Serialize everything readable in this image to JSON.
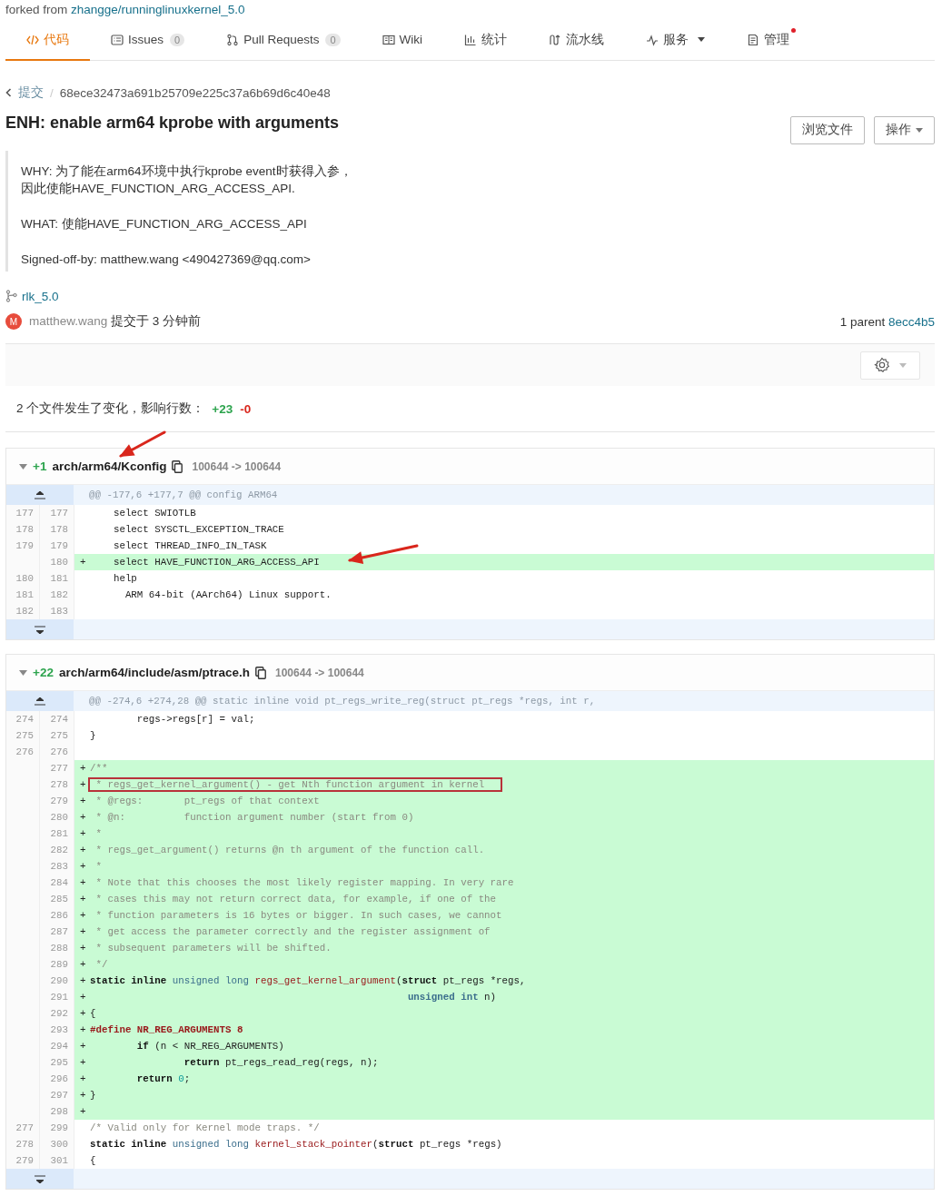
{
  "fork": {
    "prefix": "forked from",
    "link": "zhangge/runninglinuxkernel_5.0"
  },
  "tabs": [
    {
      "label": "代码",
      "selected": true
    },
    {
      "label": "Issues",
      "count": "0",
      "selected": false
    },
    {
      "label": "Pull Requests",
      "count": "0",
      "selected": false
    },
    {
      "label": "Wiki",
      "selected": false
    },
    {
      "label": "统计",
      "selected": false
    },
    {
      "label": "流水线",
      "selected": false
    },
    {
      "label": "服务",
      "dropdown": true,
      "selected": false
    },
    {
      "label": "管理",
      "notify": true,
      "selected": false
    }
  ],
  "breadcrumb": {
    "parent": "提交",
    "separator": "/",
    "current": "68ece32473a691b25709e225c37a6b69d6c40e48"
  },
  "commit": {
    "title": "ENH: enable arm64 kprobe with arguments",
    "buttons": [
      {
        "label": "浏览文件",
        "dropdown": false
      },
      {
        "label": "操作",
        "dropdown": true
      }
    ],
    "message": [
      [
        "WHY: 为了能在arm64环境中执行kprobe event时获得入参，",
        "因此使能HAVE_FUNCTION_ARG_ACCESS_API."
      ],
      [
        "WHAT: 使能HAVE_FUNCTION_ARG_ACCESS_API"
      ],
      [
        "Signed-off-by: matthew.wang <490427369@qq.com>"
      ]
    ],
    "branch": "rlk_5.0",
    "author": {
      "initial": "M",
      "name": "matthew.wang",
      "action": "提交于 3 分钟前"
    },
    "parent": {
      "label": "1 parent",
      "hash": "8ecc4b5"
    }
  },
  "stats": {
    "summary": "2 个文件发生了变化，影响行数：",
    "additions": "+23",
    "deletions": "-0"
  },
  "files": [
    {
      "additions": "+1",
      "path": "arch/arm64/Kconfig",
      "mode": "100644 -> 100644",
      "arrow": true,
      "hunk": "@@ -177,6 +177,7 @@ config ARM64",
      "lines": [
        {
          "old": "177",
          "new": "177",
          "added": false,
          "code": [
            {
              "kind": "plain",
              "text": "    select SWIOTLB"
            }
          ]
        },
        {
          "old": "178",
          "new": "178",
          "added": false,
          "code": [
            {
              "kind": "plain",
              "text": "    select SYSCTL_EXCEPTION_TRACE"
            }
          ]
        },
        {
          "old": "179",
          "new": "179",
          "added": false,
          "code": [
            {
              "kind": "plain",
              "text": "    select THREAD_INFO_IN_TASK"
            }
          ]
        },
        {
          "new": "180",
          "added": true,
          "marker": "+",
          "arrow": true,
          "code": [
            {
              "kind": "plain",
              "text": "    select HAVE_FUNCTION_ARG_ACCESS_API"
            }
          ]
        },
        {
          "old": "180",
          "new": "181",
          "added": false,
          "code": [
            {
              "kind": "plain",
              "text": "    help"
            }
          ]
        },
        {
          "old": "181",
          "new": "182",
          "added": false,
          "code": [
            {
              "kind": "plain",
              "text": "      ARM 64-bit (AArch64) Linux support."
            }
          ]
        },
        {
          "old": "182",
          "new": "183",
          "added": false
        }
      ]
    },
    {
      "additions": "+22",
      "path": "arch/arm64/include/asm/ptrace.h",
      "mode": "100644 -> 100644",
      "hunk": "@@ -274,6 +274,28 @@ static inline void pt_regs_write_reg(struct pt_regs *regs, int r,",
      "lines": [
        {
          "old": "274",
          "new": "274",
          "added": false,
          "code": [
            {
              "kind": "plain",
              "text": "        regs->regs[r] = val;"
            }
          ]
        },
        {
          "old": "275",
          "new": "275",
          "added": false,
          "code": [
            {
              "kind": "plain",
              "text": "}"
            }
          ]
        },
        {
          "old": "276",
          "new": "276",
          "added": false
        },
        {
          "new": "277",
          "added": true,
          "marker": "+",
          "code": [
            {
              "kind": "comment",
              "text": "/**"
            }
          ]
        },
        {
          "new": "278",
          "added": true,
          "marker": "+",
          "boxed": true,
          "code": [
            {
              "kind": "comment",
              "text": " * regs_get_kernel_argument() - get Nth function argument in kernel"
            }
          ]
        },
        {
          "new": "279",
          "added": true,
          "marker": "+",
          "code": [
            {
              "kind": "comment",
              "text": " * @regs:       pt_regs of that context"
            }
          ]
        },
        {
          "new": "280",
          "added": true,
          "marker": "+",
          "code": [
            {
              "kind": "comment",
              "text": " * @n:          function argument number (start from 0)"
            }
          ]
        },
        {
          "new": "281",
          "added": true,
          "marker": "+",
          "code": [
            {
              "kind": "comment",
              "text": " *"
            }
          ]
        },
        {
          "new": "282",
          "added": true,
          "marker": "+",
          "code": [
            {
              "kind": "comment",
              "text": " * regs_get_argument() returns @n th argument of the function call."
            }
          ]
        },
        {
          "new": "283",
          "added": true,
          "marker": "+",
          "code": [
            {
              "kind": "comment",
              "text": " *"
            }
          ]
        },
        {
          "new": "284",
          "added": true,
          "marker": "+",
          "code": [
            {
              "kind": "comment",
              "text": " * Note that this chooses the most likely register mapping. In very rare"
            }
          ]
        },
        {
          "new": "285",
          "added": true,
          "marker": "+",
          "code": [
            {
              "kind": "comment",
              "text": " * cases this may not return correct data, for example, if one of the"
            }
          ]
        },
        {
          "new": "286",
          "added": true,
          "marker": "+",
          "code": [
            {
              "kind": "comment",
              "text": " * function parameters is 16 bytes or bigger. In such cases, we cannot"
            }
          ]
        },
        {
          "new": "287",
          "added": true,
          "marker": "+",
          "code": [
            {
              "kind": "comment",
              "text": " * get access the parameter correctly and the register assignment of"
            }
          ]
        },
        {
          "new": "288",
          "added": true,
          "marker": "+",
          "code": [
            {
              "kind": "comment",
              "text": " * subsequent parameters will be shifted."
            }
          ]
        },
        {
          "new": "289",
          "added": true,
          "marker": "+",
          "code": [
            {
              "kind": "comment",
              "text": " */"
            }
          ]
        },
        {
          "new": "290",
          "added": true,
          "marker": "+",
          "code": [
            {
              "kind": "keyword",
              "text": "static inline "
            },
            {
              "kind": "type",
              "text": "unsigned long "
            },
            {
              "kind": "func",
              "text": "regs_get_kernel_argument"
            },
            {
              "kind": "plain",
              "text": "("
            },
            {
              "kind": "keyword",
              "text": "struct"
            },
            {
              "kind": "plain",
              "text": " pt_regs *regs,"
            }
          ]
        },
        {
          "new": "291",
          "added": true,
          "marker": "+",
          "code": [
            {
              "kind": "typebold",
              "text": "                                                      unsigned int"
            },
            {
              "kind": "plain",
              "text": " n)"
            }
          ]
        },
        {
          "new": "292",
          "added": true,
          "marker": "+",
          "code": [
            {
              "kind": "plain",
              "text": "{"
            }
          ]
        },
        {
          "new": "293",
          "added": true,
          "marker": "+",
          "code": [
            {
              "kind": "preproc",
              "text": "#define NR_REG_ARGUMENTS 8"
            }
          ]
        },
        {
          "new": "294",
          "added": true,
          "marker": "+",
          "code": [
            {
              "kind": "keyword",
              "text": "        if"
            },
            {
              "kind": "plain",
              "text": " (n < NR_REG_ARGUMENTS)"
            }
          ]
        },
        {
          "new": "295",
          "added": true,
          "marker": "+",
          "code": [
            {
              "kind": "keyword",
              "text": "                return"
            },
            {
              "kind": "plain",
              "text": " pt_regs_read_reg(regs, n);"
            }
          ]
        },
        {
          "new": "296",
          "added": true,
          "marker": "+",
          "code": [
            {
              "kind": "keyword",
              "text": "        return "
            },
            {
              "kind": "number",
              "text": "0"
            },
            {
              "kind": "plain",
              "text": ";"
            }
          ]
        },
        {
          "new": "297",
          "added": true,
          "marker": "+",
          "code": [
            {
              "kind": "plain",
              "text": "}"
            }
          ]
        },
        {
          "new": "298",
          "added": true,
          "marker": "+"
        },
        {
          "old": "277",
          "new": "299",
          "added": false,
          "code": [
            {
              "kind": "comment",
              "text": "/* Valid only for Kernel mode traps. */"
            }
          ]
        },
        {
          "old": "278",
          "new": "300",
          "added": false,
          "code": [
            {
              "kind": "keyword",
              "text": "static inline "
            },
            {
              "kind": "type",
              "text": "unsigned long "
            },
            {
              "kind": "func",
              "text": "kernel_stack_pointer"
            },
            {
              "kind": "plain",
              "text": "("
            },
            {
              "kind": "keyword",
              "text": "struct"
            },
            {
              "kind": "plain",
              "text": " pt_regs *regs)"
            }
          ]
        },
        {
          "old": "279",
          "new": "301",
          "added": false,
          "code": [
            {
              "kind": "plain",
              "text": "{"
            }
          ]
        }
      ]
    }
  ]
}
